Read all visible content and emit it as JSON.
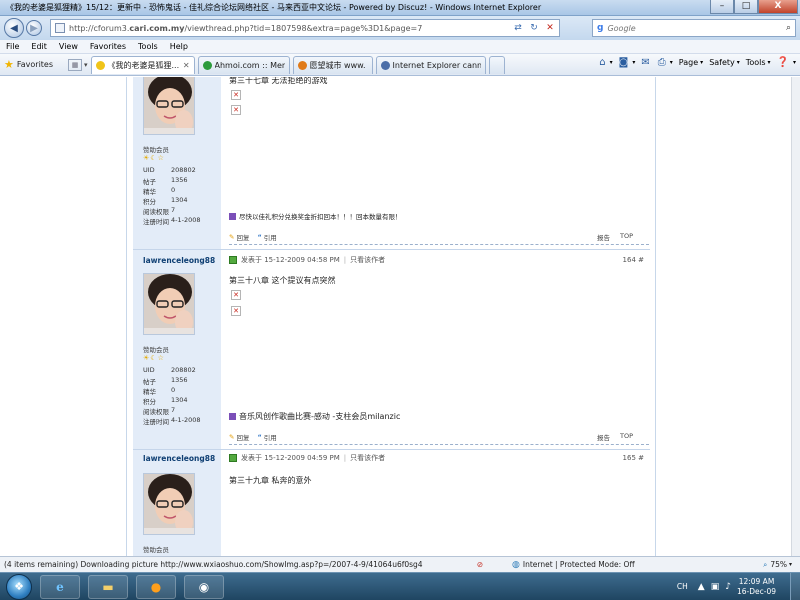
{
  "window": {
    "title": "《我的老婆是狐狸精》15/12：更新中 - 恐怖鬼话 - 佳礼综合论坛网络社区 - 马来西亚中文论坛 - Powered by Discuz! - Windows Internet Explorer",
    "min": "–",
    "max": "□",
    "close": "X"
  },
  "addressbar": {
    "url_prefix": "http://cforum3.",
    "url_domain": "cari.com.my",
    "url_path": "/viewthread.php?tid=1807598&extra=page%3D1&page=7",
    "search_placeholder": "Google"
  },
  "menu": [
    "File",
    "Edit",
    "View",
    "Favorites",
    "Tools",
    "Help"
  ],
  "favorites_label": "Favorites",
  "tabs": [
    {
      "label": "《我的老婆是狐狸...",
      "active": true,
      "color": "#f0c419"
    },
    {
      "label": "Ahmoi.com :: Memb...",
      "active": false,
      "color": "#2d9b3c"
    },
    {
      "label": "愿望城市 www. - - -",
      "active": false,
      "color": "#e07b1a"
    },
    {
      "label": "Internet Explorer cann...",
      "active": false,
      "color": "#4b6ea8"
    }
  ],
  "commands": [
    "Page",
    "Safety",
    "Tools"
  ],
  "posts": [
    {
      "username": "",
      "posted": "",
      "floor": "",
      "rank": "赞助会员",
      "stats": [
        {
          "k": "UID",
          "v": "208802"
        },
        {
          "k": "帖子",
          "v": "1356"
        },
        {
          "k": "精华",
          "v": "0"
        },
        {
          "k": "积分",
          "v": "1304"
        },
        {
          "k": "阅读权限",
          "v": "7"
        },
        {
          "k": "注册时间",
          "v": "4-1-2008"
        }
      ],
      "chapter": "第三十七章 无法拒绝的游戏",
      "signature": "尽快以佳礼积分兑换奖金折扣回本！！！回本数量有限！",
      "reply": "回复",
      "quote": "引用",
      "report": "报告",
      "top": "TOP"
    },
    {
      "username": "lawrenceleong88",
      "posted": "发表于 15-12-2009 04:58 PM",
      "only_author": "只看该作者",
      "floor": "164 #",
      "rank": "赞助会员",
      "stats": [
        {
          "k": "UID",
          "v": "208802"
        },
        {
          "k": "帖子",
          "v": "1356"
        },
        {
          "k": "精华",
          "v": "0"
        },
        {
          "k": "积分",
          "v": "1304"
        },
        {
          "k": "阅读权限",
          "v": "7"
        },
        {
          "k": "注册时间",
          "v": "4-1-2008"
        }
      ],
      "chapter": "第三十八章 这个提议有点突然",
      "signature": "音乐风创作歌曲比赛-感动 -支柱会员milanzic",
      "reply": "回复",
      "quote": "引用",
      "report": "报告",
      "top": "TOP"
    },
    {
      "username": "lawrenceleong88",
      "posted": "发表于 15-12-2009 04:59 PM",
      "only_author": "只看该作者",
      "floor": "165 #",
      "rank": "赞助会员",
      "chapter": "第三十九章 私奔的意外"
    }
  ],
  "status": {
    "text": "(4 items remaining) Downloading picture http://www.wxiaoshuo.com/ShowImg.asp?p=/2007-4-9/41064u6f0sg4",
    "zone": "Internet | Protected Mode: Off",
    "zoom": "75%"
  },
  "taskbar": {
    "lang": "CH",
    "time": "12:09 AM",
    "date": "16-Dec-09"
  }
}
